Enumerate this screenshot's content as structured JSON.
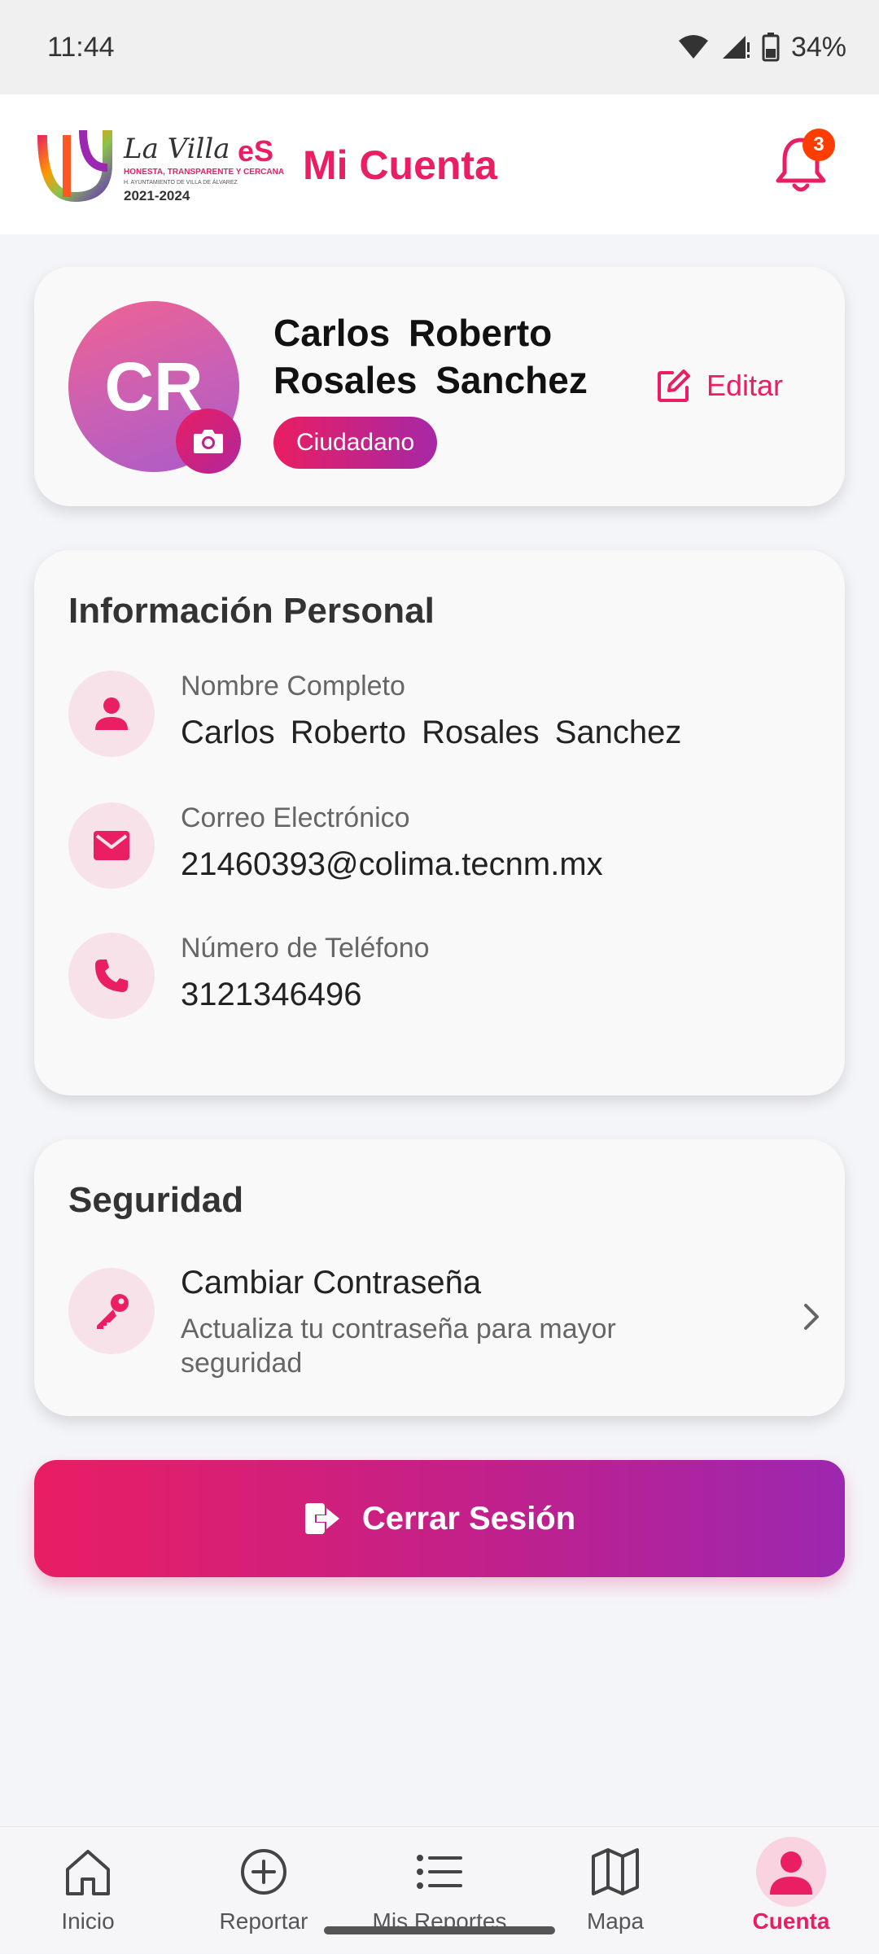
{
  "status_bar": {
    "time": "11:44",
    "battery": "34%"
  },
  "header": {
    "logo": {
      "script_text": "La Villa",
      "accent_text": "eS",
      "tagline": "HONESTA, TRANSPARENTE Y CERCANA",
      "subline": "H. AYUNTAMIENTO DE VILLA DE ÁLVAREZ",
      "years": "2021-2024"
    },
    "title": "Mi Cuenta",
    "notification_count": "3"
  },
  "profile": {
    "initials": "CR",
    "name": "Carlos  Roberto  Rosales  Sanchez",
    "role": "Ciudadano",
    "edit_label": "Editar"
  },
  "personal_info": {
    "title": "Información Personal",
    "items": [
      {
        "label": "Nombre Completo",
        "value": "Carlos  Roberto  Rosales  Sanchez",
        "icon": "person-icon"
      },
      {
        "label": "Correo Electrónico",
        "value": "21460393@colima.tecnm.mx",
        "icon": "mail-icon"
      },
      {
        "label": "Número de Teléfono",
        "value": "3121346496",
        "icon": "phone-icon"
      }
    ]
  },
  "security": {
    "title": "Seguridad",
    "change_password": {
      "title": "Cambiar Contraseña",
      "subtitle": "Actualiza tu contraseña para mayor seguridad"
    }
  },
  "logout": {
    "label": "Cerrar Sesión"
  },
  "bottom_nav": {
    "items": [
      {
        "label": "Inicio",
        "icon": "home-icon"
      },
      {
        "label": "Reportar",
        "icon": "add-circle-icon"
      },
      {
        "label": "Mis Reportes",
        "icon": "list-icon"
      },
      {
        "label": "Mapa",
        "icon": "map-icon"
      },
      {
        "label": "Cuenta",
        "icon": "account-icon",
        "active": true
      }
    ]
  },
  "colors": {
    "accent": "#e91e63",
    "accent_purple": "#9c27b0",
    "badge": "#ff3d00"
  }
}
